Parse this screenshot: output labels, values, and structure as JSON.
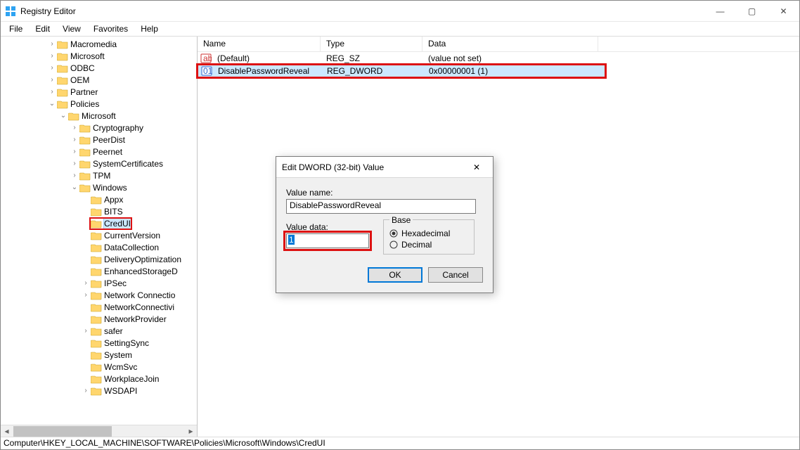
{
  "title": "Registry Editor",
  "window_controls": {
    "min": "—",
    "max": "▢",
    "close": "✕"
  },
  "menu": [
    "File",
    "Edit",
    "View",
    "Favorites",
    "Help"
  ],
  "tree": [
    {
      "indent": 4,
      "exp": ">",
      "label": "Macromedia"
    },
    {
      "indent": 4,
      "exp": ">",
      "label": "Microsoft"
    },
    {
      "indent": 4,
      "exp": ">",
      "label": "ODBC"
    },
    {
      "indent": 4,
      "exp": ">",
      "label": "OEM"
    },
    {
      "indent": 4,
      "exp": ">",
      "label": "Partner"
    },
    {
      "indent": 4,
      "exp": "v",
      "label": "Policies"
    },
    {
      "indent": 5,
      "exp": "v",
      "label": "Microsoft"
    },
    {
      "indent": 6,
      "exp": ">",
      "label": "Cryptography"
    },
    {
      "indent": 6,
      "exp": ">",
      "label": "PeerDist"
    },
    {
      "indent": 6,
      "exp": ">",
      "label": "Peernet"
    },
    {
      "indent": 6,
      "exp": ">",
      "label": "SystemCertificates"
    },
    {
      "indent": 6,
      "exp": ">",
      "label": "TPM"
    },
    {
      "indent": 6,
      "exp": "v",
      "label": "Windows"
    },
    {
      "indent": 7,
      "exp": " ",
      "label": "Appx"
    },
    {
      "indent": 7,
      "exp": " ",
      "label": "BITS"
    },
    {
      "indent": 7,
      "exp": " ",
      "label": "CredUI",
      "selected": true,
      "highlight": true
    },
    {
      "indent": 7,
      "exp": " ",
      "label": "CurrentVersion"
    },
    {
      "indent": 7,
      "exp": " ",
      "label": "DataCollection"
    },
    {
      "indent": 7,
      "exp": " ",
      "label": "DeliveryOptimization"
    },
    {
      "indent": 7,
      "exp": " ",
      "label": "EnhancedStorageD"
    },
    {
      "indent": 7,
      "exp": ">",
      "label": "IPSec"
    },
    {
      "indent": 7,
      "exp": ">",
      "label": "Network Connectio"
    },
    {
      "indent": 7,
      "exp": " ",
      "label": "NetworkConnectivi"
    },
    {
      "indent": 7,
      "exp": " ",
      "label": "NetworkProvider"
    },
    {
      "indent": 7,
      "exp": ">",
      "label": "safer"
    },
    {
      "indent": 7,
      "exp": " ",
      "label": "SettingSync"
    },
    {
      "indent": 7,
      "exp": " ",
      "label": "System"
    },
    {
      "indent": 7,
      "exp": " ",
      "label": "WcmSvc"
    },
    {
      "indent": 7,
      "exp": " ",
      "label": "WorkplaceJoin"
    },
    {
      "indent": 7,
      "exp": ">",
      "label": "WSDAPI"
    }
  ],
  "columns": {
    "name": "Name",
    "type": "Type",
    "data": "Data",
    "name_w": 175,
    "type_w": 145,
    "data_w": 250
  },
  "rows": [
    {
      "icon": "string",
      "name": "(Default)",
      "type": "REG_SZ",
      "data": "(value not set)",
      "selected": false,
      "highlight": false
    },
    {
      "icon": "dword",
      "name": "DisablePasswordReveal",
      "type": "REG_DWORD",
      "data": "0x00000001 (1)",
      "selected": true,
      "highlight": true
    }
  ],
  "statusbar": "Computer\\HKEY_LOCAL_MACHINE\\SOFTWARE\\Policies\\Microsoft\\Windows\\CredUI",
  "dialog": {
    "title": "Edit DWORD (32-bit) Value",
    "close_glyph": "✕",
    "value_name_label": "Value name:",
    "value_name": "DisablePasswordReveal",
    "value_data_label": "Value data:",
    "value_data": "1",
    "base_label": "Base",
    "hex_label": "Hexadecimal",
    "dec_label": "Decimal",
    "base_selected": "hex",
    "ok": "OK",
    "cancel": "Cancel"
  }
}
